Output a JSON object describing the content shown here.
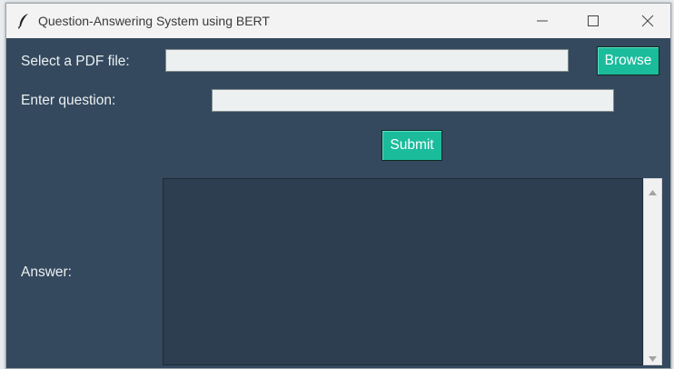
{
  "window": {
    "title": "Question-Answering System using BERT",
    "icon": "feather-icon"
  },
  "form": {
    "pdf_label": "Select a PDF file:",
    "pdf_value": "",
    "browse_label": "Browse",
    "question_label": "Enter question:",
    "question_value": "",
    "submit_label": "Submit",
    "answer_label": "Answer:",
    "answer_value": ""
  },
  "colors": {
    "background": "#34495e",
    "button": "#1abc9c",
    "entry": "#ecf0f1",
    "answer_box": "#2c3e50",
    "label_text": "#ecf0f1"
  }
}
